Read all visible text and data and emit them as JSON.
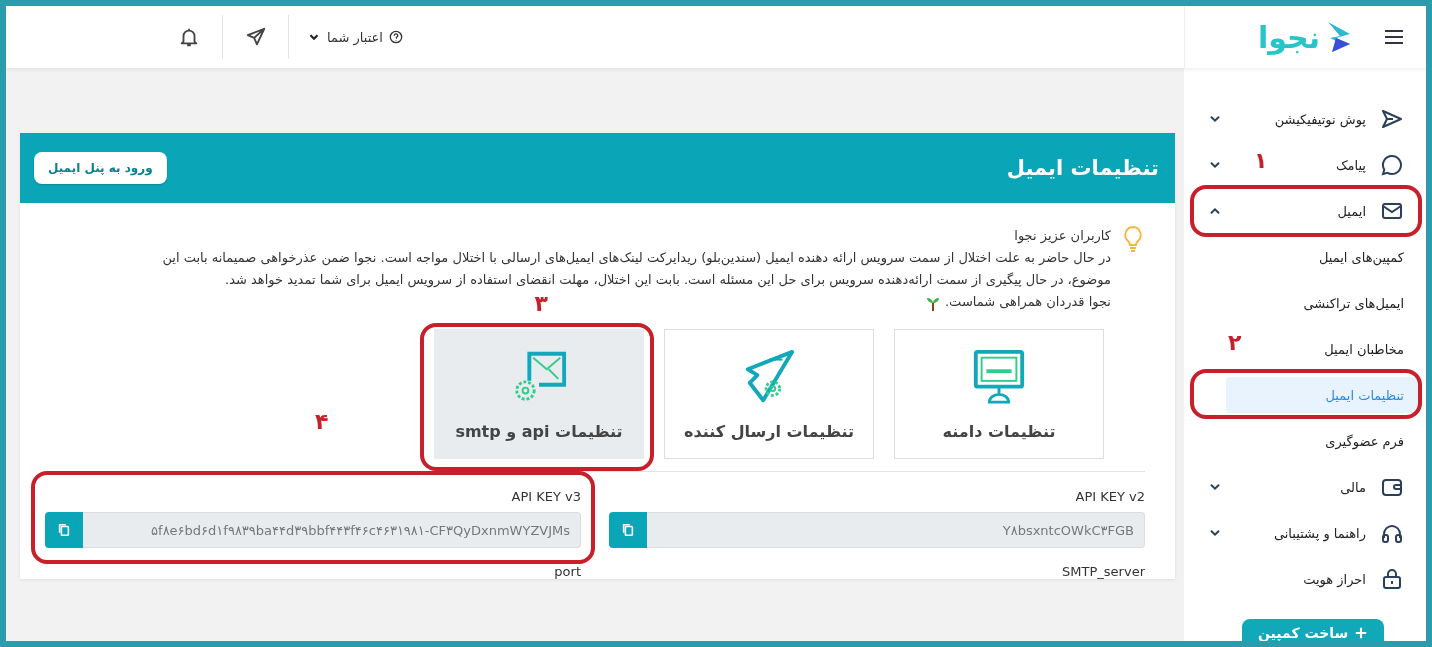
{
  "topbar": {
    "logo_text": "نجوا",
    "credit_label": "اعتبار شما"
  },
  "sidebar": {
    "items": [
      {
        "label": "پوش نوتیفیکیشن",
        "kind": "send",
        "expanded": false
      },
      {
        "label": "پیامک",
        "kind": "chat",
        "expanded": false,
        "annotation": "۱"
      },
      {
        "label": "ایمیل",
        "kind": "mail",
        "expanded": true,
        "circled": true,
        "children": [
          {
            "label": "کمپین‌های ایمیل",
            "selected": false
          },
          {
            "label": "ایمیل‌های تراکنشی",
            "selected": false
          },
          {
            "label": "مخاطبان ایمیل",
            "selected": false,
            "annotation": "۲"
          },
          {
            "label": "تنظیمات ایمیل",
            "selected": true,
            "circled": true
          },
          {
            "label": "فرم عضوگیری",
            "selected": false
          }
        ]
      },
      {
        "label": "مالی",
        "kind": "wallet",
        "expanded": false
      },
      {
        "label": "راهنما و پشتیبانی",
        "kind": "headset",
        "expanded": false
      },
      {
        "label": "احراز هویت",
        "kind": "lock"
      }
    ],
    "create_button": "ساخت کمپین"
  },
  "card": {
    "title": "تنظیمات ایمیل",
    "panel_button": "ورود به پنل ایمیل",
    "notice": {
      "title": "کاربران عزیز نجوا",
      "body": "در حال حاضر به علت اختلال از سمت سرویس ارائه دهنده ایمیل (سندین‌بلو) ریدایرکت لینک‌های ایمیل‌های ارسالی با اختلال مواجه است. نجوا ضمن عذرخواهی صمیمانه بابت این موضوع، در حال پیگیری از سمت ارائه‌دهنده سرویس برای حل این مسئله است. بابت این اختلال، مهلت انقضای استفاده از سرویس ایمیل برای شما تمدید خواهد شد.",
      "closing": "نجوا قدردان همراهی شماست."
    },
    "tiles": [
      {
        "label": "تنظیمات دامنه",
        "kind": "domain",
        "selected": false
      },
      {
        "label": "تنظیمات ارسال کننده",
        "kind": "sender",
        "selected": false
      },
      {
        "label": "تنظیمات api و smtp",
        "kind": "api",
        "selected": true,
        "circled": true,
        "annotation": "۳"
      }
    ],
    "fields": [
      {
        "label": "API KEY v2",
        "value": "Y۸bsxntcOWkC۳FGB"
      },
      {
        "label": "API KEY v3",
        "value": "۵f۸e۶bd۶d۱f۹۸۳۹ba۴۴d۳۹bbf۴۴۳f۴۶c۴۶۳۱۹۸۱-CF۳QyDxnmWYZVJMs",
        "circled": true,
        "annotation": "۴"
      }
    ],
    "next_labels": [
      "SMTP_server",
      "port"
    ]
  }
}
